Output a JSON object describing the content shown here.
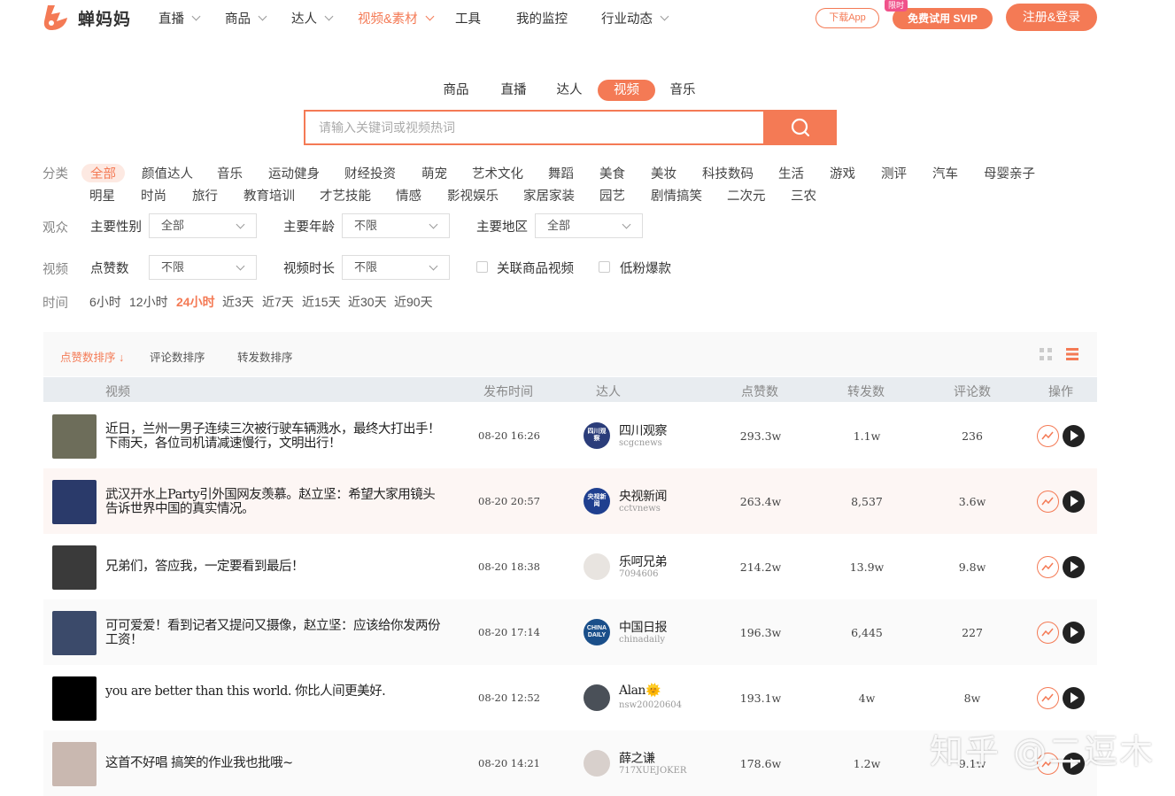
{
  "header": {
    "logo_text": "蝉妈妈",
    "nav": [
      {
        "label": "直播",
        "dropdown": true
      },
      {
        "label": "商品",
        "dropdown": true
      },
      {
        "label": "达人",
        "dropdown": true
      },
      {
        "label": "视频&素材",
        "dropdown": true,
        "active": true
      },
      {
        "label": "工具",
        "dropdown": false
      },
      {
        "label": "我的监控",
        "dropdown": false
      },
      {
        "label": "行业动态",
        "dropdown": true
      }
    ],
    "download_label": "下载App",
    "limited_badge": "限时",
    "trial_label": "免费试用 SVIP",
    "login_label": "注册&登录"
  },
  "search": {
    "tabs": [
      "商品",
      "直播",
      "达人",
      "视频",
      "音乐"
    ],
    "active_tab": "视频",
    "placeholder": "请输入关键词或视频热词"
  },
  "filters": {
    "category_label": "分类",
    "categories": [
      "全部",
      "颜值达人",
      "音乐",
      "运动健身",
      "财经投资",
      "萌宠",
      "艺术文化",
      "舞蹈",
      "美食",
      "美妆",
      "科技数码",
      "生活",
      "游戏",
      "测评",
      "汽车",
      "母婴亲子",
      "明星",
      "时尚",
      "旅行",
      "教育培训",
      "才艺技能",
      "情感",
      "影视娱乐",
      "家居家装",
      "园艺",
      "剧情搞笑",
      "二次元",
      "三农"
    ],
    "audience_label": "观众",
    "gender_label": "主要性别",
    "gender_value": "全部",
    "age_label": "主要年龄",
    "age_value": "不限",
    "region_label": "主要地区",
    "region_value": "全部",
    "video_label": "视频",
    "likes_label": "点赞数",
    "likes_value": "不限",
    "duration_label": "视频时长",
    "duration_value": "不限",
    "linked_goods_label": "关联商品视频",
    "low_fans_label": "低粉爆款",
    "time_label": "时间",
    "time_options": [
      "6小时",
      "12小时",
      "24小时",
      "近3天",
      "近7天",
      "近15天",
      "近30天",
      "近90天"
    ],
    "time_active": "24小时"
  },
  "sort": {
    "options": [
      "点赞数排序",
      "评论数排序",
      "转发数排序"
    ],
    "active": "点赞数排序"
  },
  "table": {
    "headers": {
      "video": "视频",
      "time": "发布时间",
      "author": "达人",
      "likes": "点赞数",
      "shares": "转发数",
      "comments": "评论数",
      "ops": "操作"
    },
    "rows": [
      {
        "title": "近日，兰州一男子连续三次被行驶车辆溅水，最终大打出手！下雨天，各位司机请减速慢行，文明出行！",
        "time": "08-20 16:26",
        "author": "四川观察",
        "author_id": "scgcnews",
        "likes": "293.3w",
        "shares": "1.1w",
        "comments": "236",
        "avatar_text": "四川观察",
        "avatar_color": "#2b3d7a",
        "thumb_color": "#6d6d5a"
      },
      {
        "title": "武汉开水上Party引外国网友羡慕。赵立坚：希望大家用镜头告诉世界中国的真实情况。",
        "time": "08-20 20:57",
        "author": "央视新闻",
        "author_id": "cctvnews",
        "likes": "263.4w",
        "shares": "8,537",
        "comments": "3.6w",
        "avatar_text": "央视新闻",
        "avatar_color": "#1f3f8f",
        "thumb_color": "#2a3a6a"
      },
      {
        "title": "兄弟们，答应我，一定要看到最后！",
        "time": "08-20 18:38",
        "author": "乐呵兄弟",
        "author_id": "7094606",
        "likes": "214.2w",
        "shares": "13.9w",
        "comments": "9.8w",
        "avatar_text": "",
        "avatar_color": "#e8e4e0",
        "thumb_color": "#3a3a3a"
      },
      {
        "title": "可可爱爱！看到记者又提问又摄像，赵立坚：应该给你发两份工资！",
        "time": "08-20 17:14",
        "author": "中国日报",
        "author_id": "chinadaily",
        "likes": "196.3w",
        "shares": "6,445",
        "comments": "227",
        "avatar_text": "CHINA DAILY",
        "avatar_color": "#1a4f8a",
        "thumb_color": "#3b4a6a"
      },
      {
        "title": "you are better than this world. 你比人间更美好.",
        "time": "08-20 12:52",
        "author": "Alan🌞",
        "author_id": "nsw20020604",
        "likes": "193.1w",
        "shares": "4w",
        "comments": "8w",
        "avatar_text": "",
        "avatar_color": "#4a5058",
        "thumb_color": "#000000"
      },
      {
        "title": "这首不好唱 搞笑的作业我也批哦~",
        "time": "08-20 14:21",
        "author": "薛之谦",
        "author_id": "717XUEJOKER",
        "likes": "178.6w",
        "shares": "1.2w",
        "comments": "9.1w",
        "avatar_text": "",
        "avatar_color": "#d8d0cc",
        "thumb_color": "#c9b8b0"
      }
    ]
  },
  "watermark": "知乎 @二逗木",
  "colors": {
    "accent": "#f47a55"
  }
}
